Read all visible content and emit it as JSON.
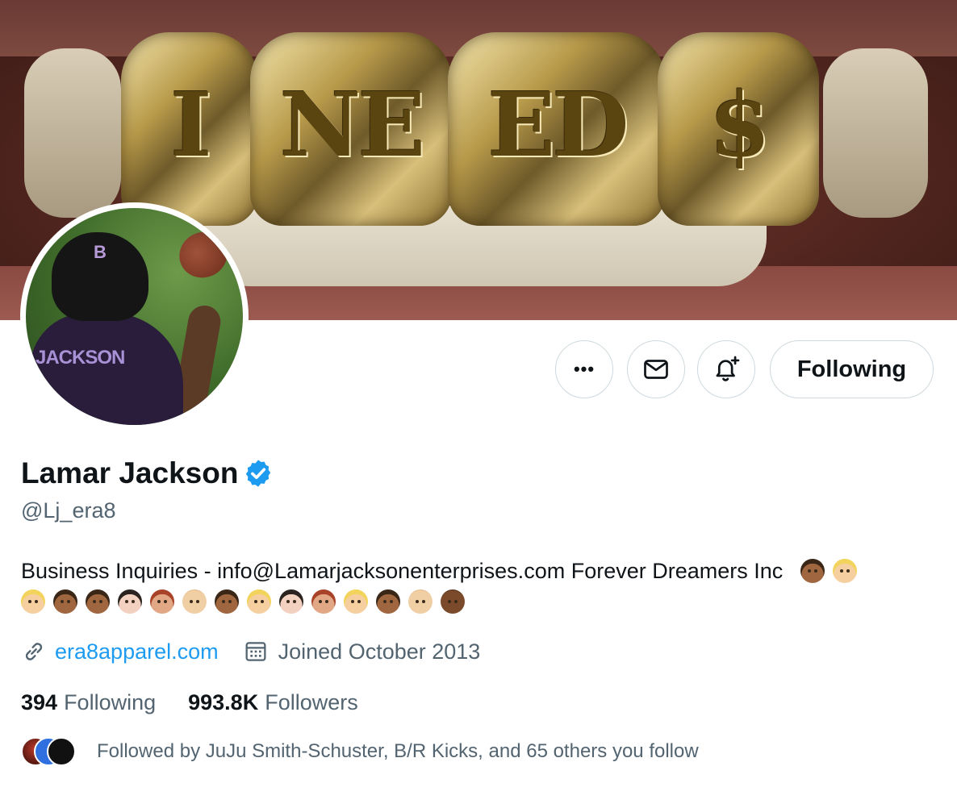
{
  "banner": {
    "engraving": [
      "I",
      "NE",
      "ED",
      "$"
    ]
  },
  "avatar": {
    "jersey_name": "JACKSON",
    "helmet_logo": "B"
  },
  "actions": {
    "more_label": "•••",
    "following_label": "Following"
  },
  "profile": {
    "display_name": "Lamar Jackson",
    "handle": "@Lj_era8",
    "bio_text": "Business Inquiries - info@Lamarjacksonenterprises.com Forever Dreamers Inc",
    "bio_emojis": [
      "boy-medium",
      "boy-blond",
      "boy-blond",
      "boy-medium",
      "boy-medium",
      "girl-light",
      "girl-red",
      "baby-light",
      "boy-medium",
      "boy-blond",
      "girl-light",
      "girl-red",
      "boy-blond",
      "boy-medium",
      "baby-light",
      "baby-dark"
    ],
    "website": "era8apparel.com",
    "joined": "Joined October 2013",
    "following_count": "394",
    "following_label": "Following",
    "followers_count": "993.8K",
    "followers_label": "Followers",
    "followed_by": "Followed by JuJu Smith-Schuster, B/R Kicks, and 65 others you follow"
  },
  "colors": {
    "accent": "#1d9bf0",
    "secondary_text": "#536471",
    "primary_text": "#0f1419",
    "border": "#cfd9de"
  },
  "icons": [
    "more-icon",
    "mail-icon",
    "bell-plus-icon",
    "verified-badge-icon",
    "link-icon",
    "calendar-icon"
  ]
}
